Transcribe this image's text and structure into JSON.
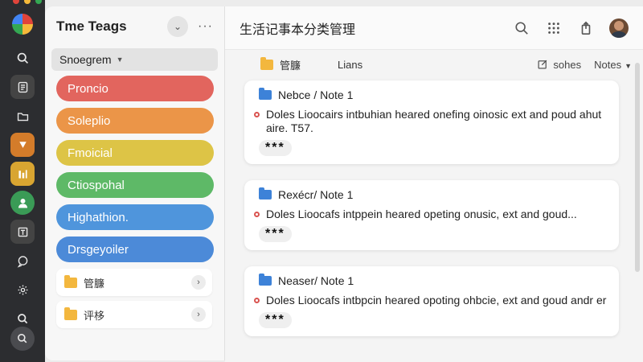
{
  "window": {
    "dot_colors": [
      "#e0443b",
      "#f5b93a",
      "#34a853"
    ]
  },
  "rail": {
    "items": [
      "app-logo",
      "search-icon",
      "notes-icon",
      "folder-icon",
      "bookmark-icon",
      "chart-icon",
      "user-icon",
      "text-icon",
      "chat-icon",
      "gear-icon",
      "search-icon"
    ]
  },
  "sidebar": {
    "title": "Tme Teags",
    "select_value": "Snoegrem",
    "tags": [
      {
        "label": "Proncio",
        "color": "#e2655e"
      },
      {
        "label": "Soleplio",
        "color": "#eb9548"
      },
      {
        "label": "Fmoicial",
        "color": "#ddc446"
      },
      {
        "label": "Ctiospohal",
        "color": "#5eb967"
      },
      {
        "label": "Highathion.",
        "color": "#4f95dc"
      },
      {
        "label": "Drsgeyoiler",
        "color": "#4c8ad8"
      }
    ],
    "folders": [
      {
        "label": "管臁"
      },
      {
        "label": "评栘"
      }
    ]
  },
  "main": {
    "title": "生活记事本分类管理",
    "subbar": {
      "folder_label": "管臁",
      "tab_label": "Lians",
      "note_button": "sohes",
      "notes_dropdown": "Notes"
    },
    "cards": [
      {
        "title": "Nebce / Note 1",
        "body": "Doles Lioocairs intbuhian heared onefing oinosic ext and poud ahut aire. T57.",
        "stars": "***"
      },
      {
        "title": "Rexécr/ Note 1",
        "body": "Doles Lioocafs intppein heared opeting onusic, ext and goud...",
        "stars": "***"
      },
      {
        "title": "Neaser/ Note 1",
        "body": "Doles Lioocafs intbpcin heared opoting ohbcie, ext and goud andr er",
        "stars": "***"
      }
    ]
  }
}
